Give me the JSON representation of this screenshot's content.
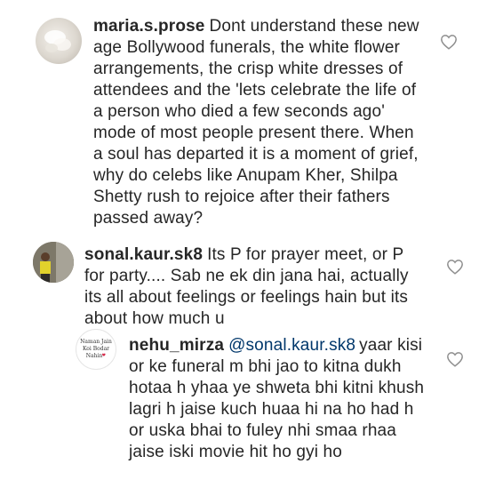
{
  "comments": [
    {
      "username": "maria.s.prose",
      "text": "Dont understand these new age Bollywood funerals, the white flower arrangements, the crisp white dresses of attendees and the 'lets celebrate the life of a person who died a few seconds ago' mode of most people present there. When a soul has departed it is a moment of grief, why do celebs like Anupam Kher, Shilpa Shetty rush to rejoice after their fathers passed away?",
      "avatar_icon": "profile-photo-flower"
    },
    {
      "username": "sonal.kaur.sk8",
      "text": "Its P for prayer meet, or P for party.... Sab ne ek din jana hai, actually its all about feelings or feelings hain but its about how much u",
      "avatar_icon": "profile-photo-person"
    },
    {
      "username": "nehu_mirza",
      "mention": "@sonal.kaur.sk8",
      "text": "yaar kisi or ke funeral m bhi jao to kitna dukh hotaa h yhaa ye shweta bhi kitni khush lagri h jaise kuch huaa hi na ho had h or uska bhai to fuley nhi smaa rhaa jaise iski movie hit ho gyi ho",
      "avatar_text": "Naman Jain\nKoi Bodar\nNahin",
      "avatar_icon": "profile-photo-text"
    }
  ],
  "icons": {
    "like": "heart-outline-icon"
  },
  "colors": {
    "text": "#262626",
    "mention": "#00376b",
    "icon": "#8e8e8e"
  }
}
